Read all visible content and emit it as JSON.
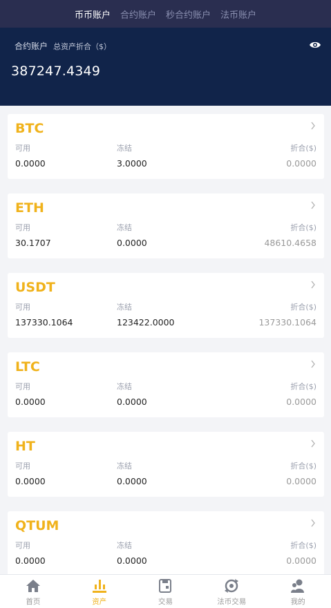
{
  "top_tabs": [
    {
      "label": "币币账户",
      "active": true
    },
    {
      "label": "合约账户",
      "active": false
    },
    {
      "label": "秒合约账户",
      "active": false
    },
    {
      "label": "法币账户",
      "active": false
    }
  ],
  "header": {
    "account_label": "合约账户",
    "total_label": "总资产折合（$）",
    "total_value": "387247.4349",
    "eye_icon": "eye-icon"
  },
  "column_labels": {
    "available": "可用",
    "frozen": "冻结",
    "converted": "折合($)"
  },
  "assets": [
    {
      "coin": "BTC",
      "available": "0.0000",
      "frozen": "3.0000",
      "converted": "0.0000"
    },
    {
      "coin": "ETH",
      "available": "30.1707",
      "frozen": "0.0000",
      "converted": "48610.4658"
    },
    {
      "coin": "USDT",
      "available": "137330.1064",
      "frozen": "123422.0000",
      "converted": "137330.1064"
    },
    {
      "coin": "LTC",
      "available": "0.0000",
      "frozen": "0.0000",
      "converted": "0.0000"
    },
    {
      "coin": "HT",
      "available": "0.0000",
      "frozen": "0.0000",
      "converted": "0.0000"
    },
    {
      "coin": "QTUM",
      "available": "0.0000",
      "frozen": "0.0000",
      "converted": "0.0000"
    }
  ],
  "bottom_nav": [
    {
      "label": "首页",
      "icon": "home-icon",
      "active": false
    },
    {
      "label": "资产",
      "icon": "assets-icon",
      "active": true
    },
    {
      "label": "交易",
      "icon": "trade-icon",
      "active": false
    },
    {
      "label": "法币交易",
      "icon": "fiat-icon",
      "active": false
    },
    {
      "label": "我的",
      "icon": "user-icon",
      "active": false
    }
  ],
  "colors": {
    "accent": "#f0b21b",
    "header_bg": "#11244a",
    "tabs_bg": "#2a2e50"
  }
}
